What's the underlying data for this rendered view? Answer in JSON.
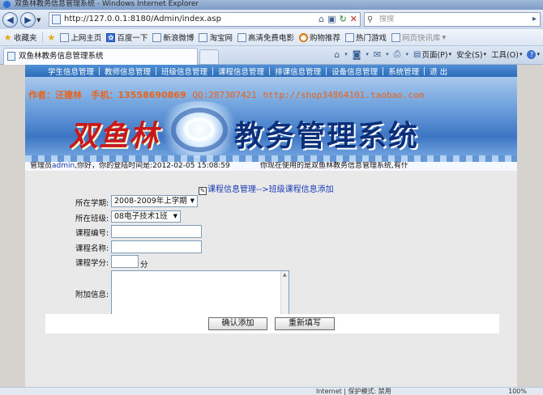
{
  "window": {
    "title": "双鱼林教务信息管理系统 - Windows Internet Explorer"
  },
  "addressbar": {
    "url": "http://127.0.0.1:8180/Admin/index.asp",
    "search_placeholder": "搜搜"
  },
  "favorites": {
    "label": "收藏夹",
    "items": [
      {
        "label": "上网主页",
        "icon": "page-icon"
      },
      {
        "label": "百度一下",
        "icon": "paw-icon"
      },
      {
        "label": "新浪微博",
        "icon": "page-icon"
      },
      {
        "label": "淘宝网",
        "icon": "page-icon"
      },
      {
        "label": "高清免费电影",
        "icon": "page-icon"
      },
      {
        "label": "购物推荐",
        "icon": "orange-circle-icon"
      },
      {
        "label": "热门游戏",
        "icon": "page-icon"
      },
      {
        "label": "网页快讯库",
        "icon": "page-icon"
      }
    ]
  },
  "tab": {
    "label": "双鱼林教务信息管理系统"
  },
  "commandbar": {
    "page": "页面(P)",
    "safety": "安全(S)",
    "tools": "工具(O)"
  },
  "topnav": {
    "items": [
      "学生信息管理",
      "教师信息管理",
      "班级信息管理",
      "课程信息管理",
      "排课信息管理",
      "设备信息管理",
      "系统管理",
      "退 出"
    ]
  },
  "banner": {
    "author": "作者：汪建林",
    "phone": "手机：13558690869",
    "qq": "QQ:287307421",
    "shop": "http://shop34864101.taobao.com",
    "name": "双鱼林",
    "system_title": "教务管理系统"
  },
  "infobar": {
    "admin_prefix": "管理员",
    "admin_user": "admin",
    "login_text": ",你好，你的登陆时间是:2012-02-05 15:08:59",
    "system_text": "你现在使用的是双鱼林教务信息管理系统,有什"
  },
  "form": {
    "breadcrumb": "课程信息管理-->班级课程信息添加",
    "term_label": "所在学期:",
    "term_value": "2008-2009年上学期",
    "class_label": "所在班级:",
    "class_value": "08电子技术1班",
    "course_no_label": "课程编号:",
    "course_no_value": "",
    "course_name_label": "课程名称:",
    "course_name_value": "",
    "credit_label": "课程学分:",
    "credit_value": "",
    "credit_unit": "分",
    "extra_label": "附加信息:",
    "extra_value": "",
    "submit_label": "确认添加",
    "reset_label": "重新填写"
  },
  "statusbar": {
    "zone": "Internet | 保护模式: 禁用",
    "zoom": "100%"
  }
}
